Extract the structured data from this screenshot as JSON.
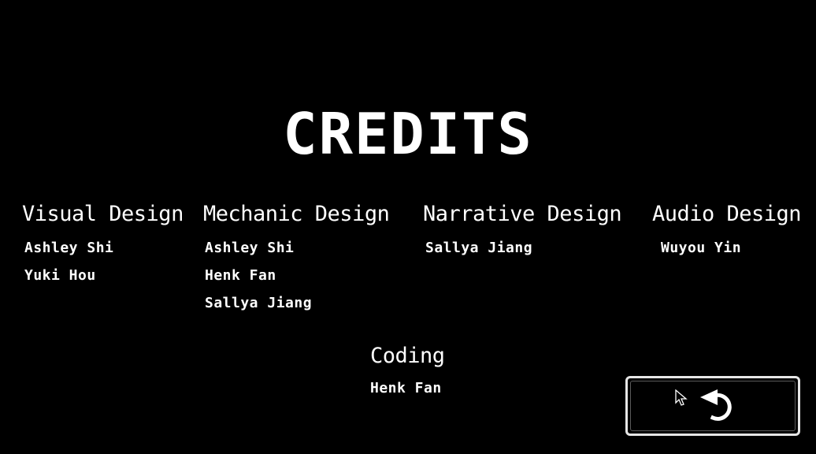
{
  "title": "CREDITS",
  "sections": {
    "visual": {
      "heading": "Visual Design",
      "names": [
        "Ashley Shi",
        "Yuki Hou"
      ]
    },
    "mechanic": {
      "heading": "Mechanic Design",
      "names": [
        "Ashley Shi",
        "Henk Fan",
        "Sallya Jiang"
      ]
    },
    "narrative": {
      "heading": "Narrative Design",
      "names": [
        "Sallya Jiang"
      ]
    },
    "audio": {
      "heading": "Audio Design",
      "names": [
        "Wuyou Yin"
      ]
    },
    "coding": {
      "heading": "Coding",
      "names": [
        "Henk Fan"
      ]
    }
  },
  "back_button": {
    "icon": "undo-arrow-icon"
  },
  "cursor": {
    "icon": "mouse-pointer-icon"
  },
  "colors": {
    "background": "#000000",
    "text": "#ffffff",
    "button_border": "#e6e6e6"
  }
}
